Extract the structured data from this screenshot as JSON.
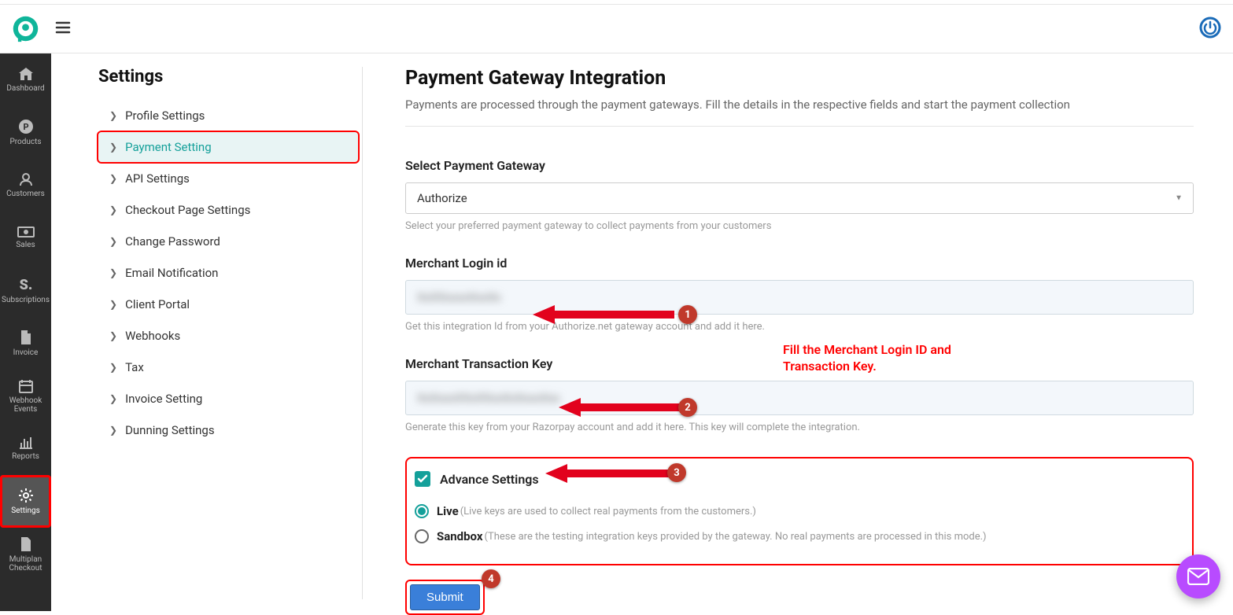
{
  "sidebar": {
    "items": [
      {
        "label": "Dashboard"
      },
      {
        "label": "Products"
      },
      {
        "label": "Customers"
      },
      {
        "label": "Sales"
      },
      {
        "label": "Subscriptions"
      },
      {
        "label": "Invoice"
      },
      {
        "label": "Webhook Events"
      },
      {
        "label": "Reports"
      },
      {
        "label": "Settings"
      },
      {
        "label": "Multiplan Checkout"
      }
    ]
  },
  "subnav": {
    "heading": "Settings",
    "items": [
      {
        "label": "Profile Settings"
      },
      {
        "label": "Payment Setting"
      },
      {
        "label": "API Settings"
      },
      {
        "label": " Checkout Page Settings"
      },
      {
        "label": "Change Password"
      },
      {
        "label": "Email Notification"
      },
      {
        "label": "Client Portal"
      },
      {
        "label": "Webhooks"
      },
      {
        "label": "Tax"
      },
      {
        "label": "Invoice Setting"
      },
      {
        "label": "Dunning Settings"
      }
    ]
  },
  "main": {
    "title": "Payment Gateway Integration",
    "subtitle": "Payments are processed through the payment gateways. Fill the details in the respective fields and start the payment collection",
    "sel_label": "Select Payment Gateway",
    "sel_value": "Authorize",
    "sel_helper": "Select your preferred payment gateway to collect payments from your customers",
    "login_label": "Merchant Login id",
    "login_helper": "Get this integration Id from your Authorize.net gateway account and add it here.",
    "tkey_label": "Merchant Transaction Key",
    "tkey_helper": "Generate this key from your Razorpay account and add it here. This key will complete the integration.",
    "adv_label": "Advance Settings",
    "live_label": "Live",
    "live_desc": "(Live keys are used to collect real payments from the customers.)",
    "sbox_label": "Sandbox",
    "sbox_desc": "(These are the testing integration keys provided by the gateway. No real payments are processed in this mode.)",
    "submit": "Submit"
  },
  "annotation": {
    "text": "Fill the Merchant Login ID and Transaction Key.",
    "n1": "1",
    "n2": "2",
    "n3": "3",
    "n4": "4"
  }
}
